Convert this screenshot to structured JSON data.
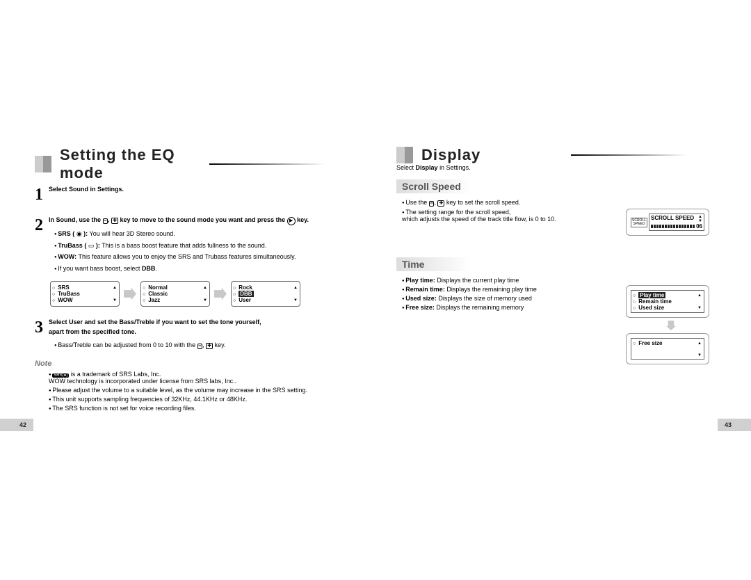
{
  "left": {
    "title": "Setting the EQ mode",
    "step1": "Select Sound in Settings.",
    "step2_a": "In Sound, use the ",
    "step2_b": " key to move to the sound mode you want and press the ",
    "step2_c": " key.",
    "bullets2": {
      "srs_label": "SRS ( ",
      "srs_suffix": " ):",
      "srs_text": "You will hear 3D Stereo sound.",
      "trubass_label": "TruBass ( ",
      "trubass_suffix": " ):",
      "trubass_text": "This is a bass boost feature that adds fullness to the sound.",
      "wow_label": "WOW:",
      "wow_text": "This feature allows you to enjoy the SRS and Trubass features simultaneously.",
      "bassboost": "If you want bass boost, select",
      "bassboost_dbb": "DBB"
    },
    "menu1": [
      "SRS",
      "TruBass",
      "WOW"
    ],
    "menu2": [
      "Normal",
      "Classic",
      "Jazz"
    ],
    "menu3": [
      "Rock",
      "DBB",
      "User"
    ],
    "step3_a": "Select User and set the Bass/Treble if you want to set the tone yourself,",
    "step3_b": "apart from the specified tone.",
    "step3_bullet": "Bass/Treble can be adjusted from 0 to 10 with the ",
    "step3_bullet_end": " key.",
    "note_hdr": "Note",
    "notes": [
      "is a trademark of SRS Labs, Inc.",
      "WOW technology is incorporated under license from SRS labs, Inc..",
      "Please adjust the volume to a suitable level, as the volume may increase in the SRS setting.",
      "This unit supports sampling frequencies of 32KHz, 44.1KHz or 48KHz.",
      "The SRS function is not set for voice recording files."
    ],
    "srs_logo": "SRS(●)",
    "pageno": "42"
  },
  "right": {
    "title": "Display",
    "intro": "Select",
    "intro_b": "Display",
    "intro_c": "in Settings.",
    "scroll_hdr": "Scroll Speed",
    "scroll_b1": "Use the ",
    "scroll_b1_end": " key to set the scroll speed.",
    "scroll_b2a": "The setting range for the scroll speed,",
    "scroll_b2b": "which adjusts the speed of the track title flow, is  0 to 10.",
    "lcd_scroll_label": "SCROLL SPEED",
    "lcd_scroll_side": "SCROLL\nSPEED",
    "lcd_scroll_val": "06",
    "time_hdr": "Time",
    "time_items": [
      {
        "label": "Play time:",
        "text": "Displays the current play time"
      },
      {
        "label": "Remain time:",
        "text": "Displays the remaining play time"
      },
      {
        "label": "Used size:",
        "text": "Displays the size of memory used"
      },
      {
        "label": "Free size:",
        "text": "Displays the remaining memory"
      }
    ],
    "lcd_time_rows1": [
      "Play time",
      "Remain time",
      "Used size"
    ],
    "lcd_time_rows2": [
      "Free size"
    ],
    "pageno": "43"
  },
  "symbols": {
    "minus": "−",
    "plus": "+",
    "comma": ", "
  }
}
